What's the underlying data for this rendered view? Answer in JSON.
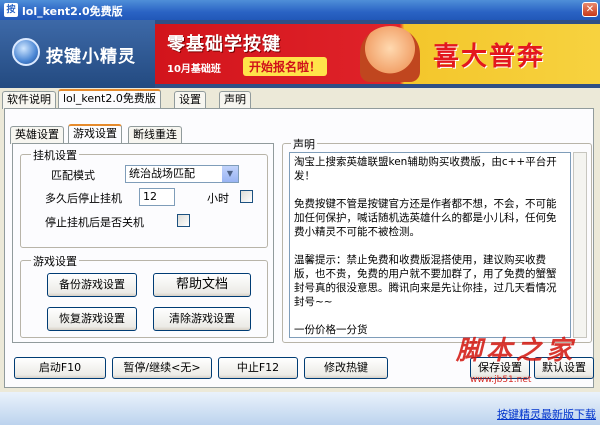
{
  "window": {
    "title": "lol_kent2.0免费版",
    "close_symbol": "✕",
    "app_icon_symbol": "按"
  },
  "banner": {
    "logo_text": "按键小精灵",
    "ad_title": "零基础学按键",
    "ad_date": "10月基础班",
    "ad_badge": "开始报名啦！",
    "ad_big": "喜大普奔"
  },
  "top_tabs": [
    "软件说明",
    "lol_kent2.0免费版",
    "设置",
    "声明"
  ],
  "sub_tabs": [
    "英雄设置",
    "游戏设置",
    "断线重连"
  ],
  "hang_settings": {
    "legend": "挂机设置",
    "match_mode_label": "匹配模式",
    "match_mode_value": "统治战场匹配",
    "stop_after_label": "多久后停止挂机",
    "stop_after_value": "12",
    "stop_after_unit": "小时",
    "shutdown_label": "停止挂机后是否关机"
  },
  "game_settings": {
    "legend": "游戏设置",
    "backup_button": "备份游戏设置",
    "help_button": "帮助文档",
    "restore_button": "恢复游戏设置",
    "clear_button": "清除游戏设置"
  },
  "notice": {
    "legend": "声明",
    "text": "淘宝上搜索英雄联盟ken辅助购买收费版，由c++平台开发！\n\n免费按键不管是按键官方还是作者都不想，不会，不可能加任何保护，喊话随机选英雄什么的都是小儿科，任何免费小精灵不可能不被检测。\n\n温馨提示：禁止免费和收费版混搭使用，建议购买收费版，也不贵，免费的用户就不要加群了，用了免费的蟹蟹封号真的很没意思。腾讯向来是先让你挂，过几天看情况封号~~\n\n一份价格一分货"
  },
  "bottom_buttons": {
    "start": "启动F10",
    "pause": "暂停/继续<无>",
    "stop": "中止F12",
    "hotkey": "修改热键",
    "save": "保存设置",
    "reset": "默认设置"
  },
  "status": {
    "update_link": "按键精灵最新版下载"
  },
  "watermark": {
    "text": "脚本之家",
    "url": "www.jb51.net"
  }
}
